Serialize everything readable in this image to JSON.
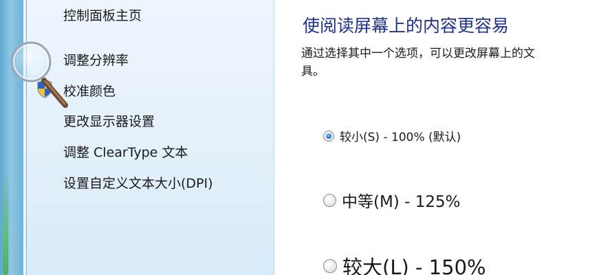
{
  "sidebar": {
    "items": [
      {
        "label": "控制面板主页"
      },
      {
        "label": "调整分辨率"
      },
      {
        "label": "校准颜色"
      },
      {
        "label": "更改显示器设置"
      },
      {
        "label": "调整 ClearType 文本"
      },
      {
        "label": "设置自定义文本大小(DPI)"
      }
    ]
  },
  "main": {
    "title": "使阅读屏幕上的内容更容易",
    "description_line1": "通过选择其中一个选项，可以更改屏幕上的文",
    "description_line2": "具。",
    "options": [
      {
        "label": "较小(S) - 100% (默认)",
        "selected": true
      },
      {
        "label": "中等(M) - 125%",
        "selected": false
      },
      {
        "label": "较大(L) - 150%",
        "selected": false
      }
    ]
  },
  "icons": {
    "shield": "uac-shield-icon",
    "magnifier": "magnifier-icon"
  },
  "colors": {
    "title": "#1e3287",
    "pane_background": "#e3f0fa",
    "frame": "#6fb2d6"
  }
}
